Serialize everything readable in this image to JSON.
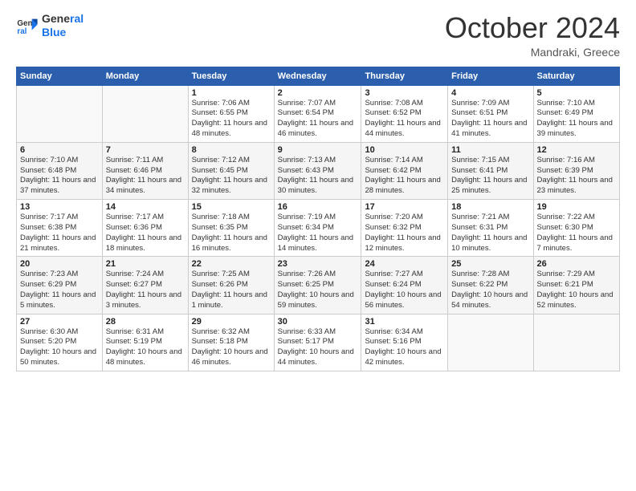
{
  "logo": {
    "line1": "General",
    "line2": "Blue"
  },
  "header": {
    "month": "October 2024",
    "location": "Mandraki, Greece"
  },
  "days_of_week": [
    "Sunday",
    "Monday",
    "Tuesday",
    "Wednesday",
    "Thursday",
    "Friday",
    "Saturday"
  ],
  "weeks": [
    [
      {
        "day": "",
        "info": ""
      },
      {
        "day": "",
        "info": ""
      },
      {
        "day": "1",
        "info": "Sunrise: 7:06 AM\nSunset: 6:55 PM\nDaylight: 11 hours and 48 minutes."
      },
      {
        "day": "2",
        "info": "Sunrise: 7:07 AM\nSunset: 6:54 PM\nDaylight: 11 hours and 46 minutes."
      },
      {
        "day": "3",
        "info": "Sunrise: 7:08 AM\nSunset: 6:52 PM\nDaylight: 11 hours and 44 minutes."
      },
      {
        "day": "4",
        "info": "Sunrise: 7:09 AM\nSunset: 6:51 PM\nDaylight: 11 hours and 41 minutes."
      },
      {
        "day": "5",
        "info": "Sunrise: 7:10 AM\nSunset: 6:49 PM\nDaylight: 11 hours and 39 minutes."
      }
    ],
    [
      {
        "day": "6",
        "info": "Sunrise: 7:10 AM\nSunset: 6:48 PM\nDaylight: 11 hours and 37 minutes."
      },
      {
        "day": "7",
        "info": "Sunrise: 7:11 AM\nSunset: 6:46 PM\nDaylight: 11 hours and 34 minutes."
      },
      {
        "day": "8",
        "info": "Sunrise: 7:12 AM\nSunset: 6:45 PM\nDaylight: 11 hours and 32 minutes."
      },
      {
        "day": "9",
        "info": "Sunrise: 7:13 AM\nSunset: 6:43 PM\nDaylight: 11 hours and 30 minutes."
      },
      {
        "day": "10",
        "info": "Sunrise: 7:14 AM\nSunset: 6:42 PM\nDaylight: 11 hours and 28 minutes."
      },
      {
        "day": "11",
        "info": "Sunrise: 7:15 AM\nSunset: 6:41 PM\nDaylight: 11 hours and 25 minutes."
      },
      {
        "day": "12",
        "info": "Sunrise: 7:16 AM\nSunset: 6:39 PM\nDaylight: 11 hours and 23 minutes."
      }
    ],
    [
      {
        "day": "13",
        "info": "Sunrise: 7:17 AM\nSunset: 6:38 PM\nDaylight: 11 hours and 21 minutes."
      },
      {
        "day": "14",
        "info": "Sunrise: 7:17 AM\nSunset: 6:36 PM\nDaylight: 11 hours and 18 minutes."
      },
      {
        "day": "15",
        "info": "Sunrise: 7:18 AM\nSunset: 6:35 PM\nDaylight: 11 hours and 16 minutes."
      },
      {
        "day": "16",
        "info": "Sunrise: 7:19 AM\nSunset: 6:34 PM\nDaylight: 11 hours and 14 minutes."
      },
      {
        "day": "17",
        "info": "Sunrise: 7:20 AM\nSunset: 6:32 PM\nDaylight: 11 hours and 12 minutes."
      },
      {
        "day": "18",
        "info": "Sunrise: 7:21 AM\nSunset: 6:31 PM\nDaylight: 11 hours and 10 minutes."
      },
      {
        "day": "19",
        "info": "Sunrise: 7:22 AM\nSunset: 6:30 PM\nDaylight: 11 hours and 7 minutes."
      }
    ],
    [
      {
        "day": "20",
        "info": "Sunrise: 7:23 AM\nSunset: 6:29 PM\nDaylight: 11 hours and 5 minutes."
      },
      {
        "day": "21",
        "info": "Sunrise: 7:24 AM\nSunset: 6:27 PM\nDaylight: 11 hours and 3 minutes."
      },
      {
        "day": "22",
        "info": "Sunrise: 7:25 AM\nSunset: 6:26 PM\nDaylight: 11 hours and 1 minute."
      },
      {
        "day": "23",
        "info": "Sunrise: 7:26 AM\nSunset: 6:25 PM\nDaylight: 10 hours and 59 minutes."
      },
      {
        "day": "24",
        "info": "Sunrise: 7:27 AM\nSunset: 6:24 PM\nDaylight: 10 hours and 56 minutes."
      },
      {
        "day": "25",
        "info": "Sunrise: 7:28 AM\nSunset: 6:22 PM\nDaylight: 10 hours and 54 minutes."
      },
      {
        "day": "26",
        "info": "Sunrise: 7:29 AM\nSunset: 6:21 PM\nDaylight: 10 hours and 52 minutes."
      }
    ],
    [
      {
        "day": "27",
        "info": "Sunrise: 6:30 AM\nSunset: 5:20 PM\nDaylight: 10 hours and 50 minutes."
      },
      {
        "day": "28",
        "info": "Sunrise: 6:31 AM\nSunset: 5:19 PM\nDaylight: 10 hours and 48 minutes."
      },
      {
        "day": "29",
        "info": "Sunrise: 6:32 AM\nSunset: 5:18 PM\nDaylight: 10 hours and 46 minutes."
      },
      {
        "day": "30",
        "info": "Sunrise: 6:33 AM\nSunset: 5:17 PM\nDaylight: 10 hours and 44 minutes."
      },
      {
        "day": "31",
        "info": "Sunrise: 6:34 AM\nSunset: 5:16 PM\nDaylight: 10 hours and 42 minutes."
      },
      {
        "day": "",
        "info": ""
      },
      {
        "day": "",
        "info": ""
      }
    ]
  ]
}
